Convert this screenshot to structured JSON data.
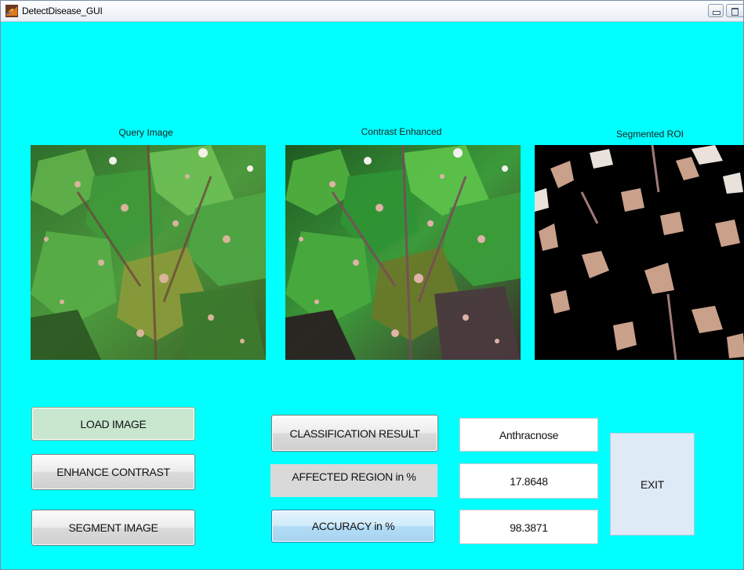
{
  "window": {
    "title": "DetectDisease_GUI"
  },
  "panels": {
    "query": {
      "label": "Query Image"
    },
    "enhanced": {
      "label": "Contrast Enhanced"
    },
    "segmented": {
      "label": "Segmented ROI"
    }
  },
  "buttons": {
    "load": "LOAD IMAGE",
    "enhance": "ENHANCE CONTRAST",
    "segment": "SEGMENT IMAGE",
    "classify": "CLASSIFICATION RESULT",
    "affected": "AFFECTED REGION in %",
    "accuracy": "ACCURACY in %",
    "exit": "EXIT"
  },
  "results": {
    "classification": "Anthracnose",
    "affected_region": "17.8648",
    "accuracy": "98.3871"
  },
  "colors": {
    "background": "#00ffff",
    "leaf_green": "#3f8f3a",
    "lesion": "#c9a08a"
  },
  "icons": {
    "app": "matlab-icon",
    "minimize": "minimize-icon",
    "maximize": "maximize-icon"
  }
}
